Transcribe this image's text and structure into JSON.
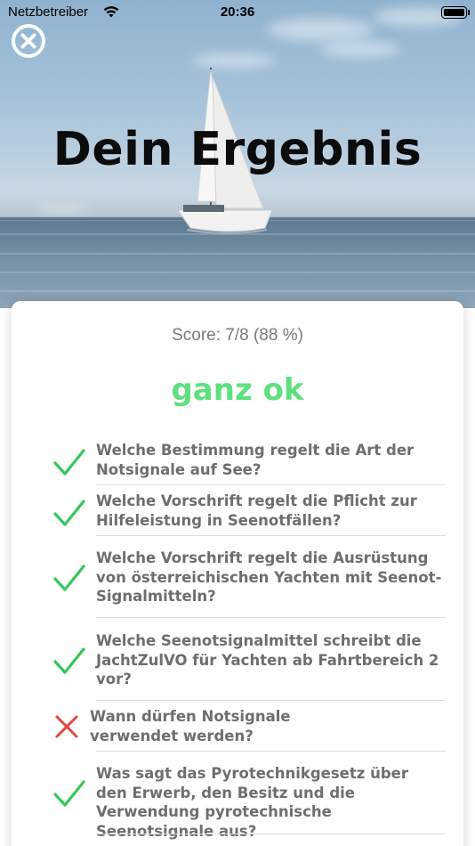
{
  "status_bar": {
    "carrier": "Netzbetreiber",
    "time": "20:36"
  },
  "hero": {
    "title": "Dein Ergebnis"
  },
  "result": {
    "score_text": "Score: 7/8 (88 %)",
    "verdict": "ganz ok",
    "colors": {
      "correct": "#34c759",
      "wrong": "#e5473e",
      "verdict": "#5ee07e"
    }
  },
  "questions": [
    {
      "text": "Welche Bestimmung regelt die Art der Notsignale auf See?",
      "correct": true
    },
    {
      "text": "Welche Vorschrift regelt die Pflicht zur Hilfeleistung in Seenotfällen?",
      "correct": true
    },
    {
      "text": "Welche Vorschrift regelt die Ausrüstung von österreichischen Yachten mit Seenot-Signalmitteln?",
      "correct": true
    },
    {
      "text": "Welche Seenotsignalmittel schreibt die JachtZulVO für Yachten ab Fahrtbereich 2 vor?",
      "correct": true
    },
    {
      "text": "Wann dürfen Notsignale verwendet werden?",
      "correct": false
    },
    {
      "text": "Was sagt das Pyrotechnikgesetz über den Erwerb, den Besitz und die Verwendung pyrotechnische Seenotsignale aus?",
      "correct": true
    }
  ]
}
